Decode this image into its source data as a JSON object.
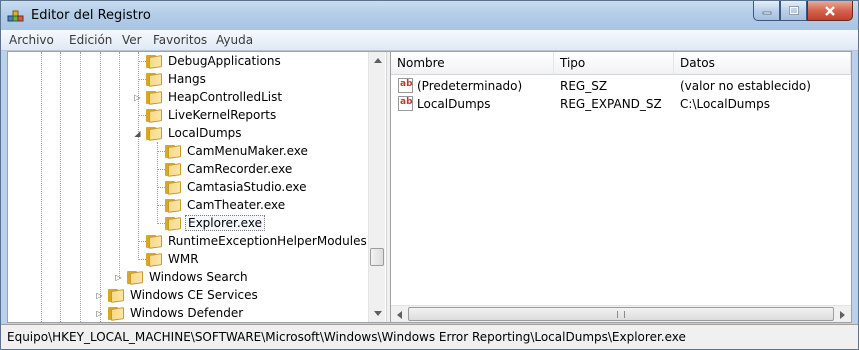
{
  "window": {
    "title": "Editor del Registro"
  },
  "menu": [
    "Archivo",
    "Edición",
    "Ver",
    "Favoritos",
    "Ayuda"
  ],
  "tree": {
    "items": [
      {
        "label": "DebugApplications",
        "expander": ""
      },
      {
        "label": "Hangs",
        "expander": ""
      },
      {
        "label": "HeapControlledList",
        "expander": "▷"
      },
      {
        "label": "LiveKernelReports",
        "expander": ""
      },
      {
        "label": "LocalDumps",
        "expander": "◢"
      },
      {
        "label": "CamMenuMaker.exe",
        "expander": ""
      },
      {
        "label": "CamRecorder.exe",
        "expander": ""
      },
      {
        "label": "CamtasiaStudio.exe",
        "expander": ""
      },
      {
        "label": "CamTheater.exe",
        "expander": ""
      },
      {
        "label": "Explorer.exe",
        "expander": "",
        "selected": true
      },
      {
        "label": "RuntimeExceptionHelperModules",
        "expander": ""
      },
      {
        "label": "WMR",
        "expander": ""
      },
      {
        "label": "Windows Search",
        "expander": "▷"
      },
      {
        "label": "Windows CE Services",
        "expander": "▷"
      },
      {
        "label": "Windows Defender",
        "expander": "▷"
      }
    ]
  },
  "values": {
    "columns": [
      "Nombre",
      "Tipo",
      "Datos"
    ],
    "rows": [
      {
        "name": "(Predeterminado)",
        "type": "REG_SZ",
        "data": "(valor no establecido)",
        "icon": "string-value-icon"
      },
      {
        "name": "LocalDumps",
        "type": "REG_EXPAND_SZ",
        "data": "C:\\LocalDumps",
        "icon": "string-value-icon"
      }
    ]
  },
  "status": {
    "path": "Equipo\\HKEY_LOCAL_MACHINE\\SOFTWARE\\Microsoft\\Windows\\Windows Error Reporting\\LocalDumps\\Explorer.exe"
  },
  "icons": {
    "ab": "ab"
  },
  "colors": {
    "folder": "#f7d98a",
    "close_button": "#c3402a",
    "title_bar": "#b4cde8"
  }
}
